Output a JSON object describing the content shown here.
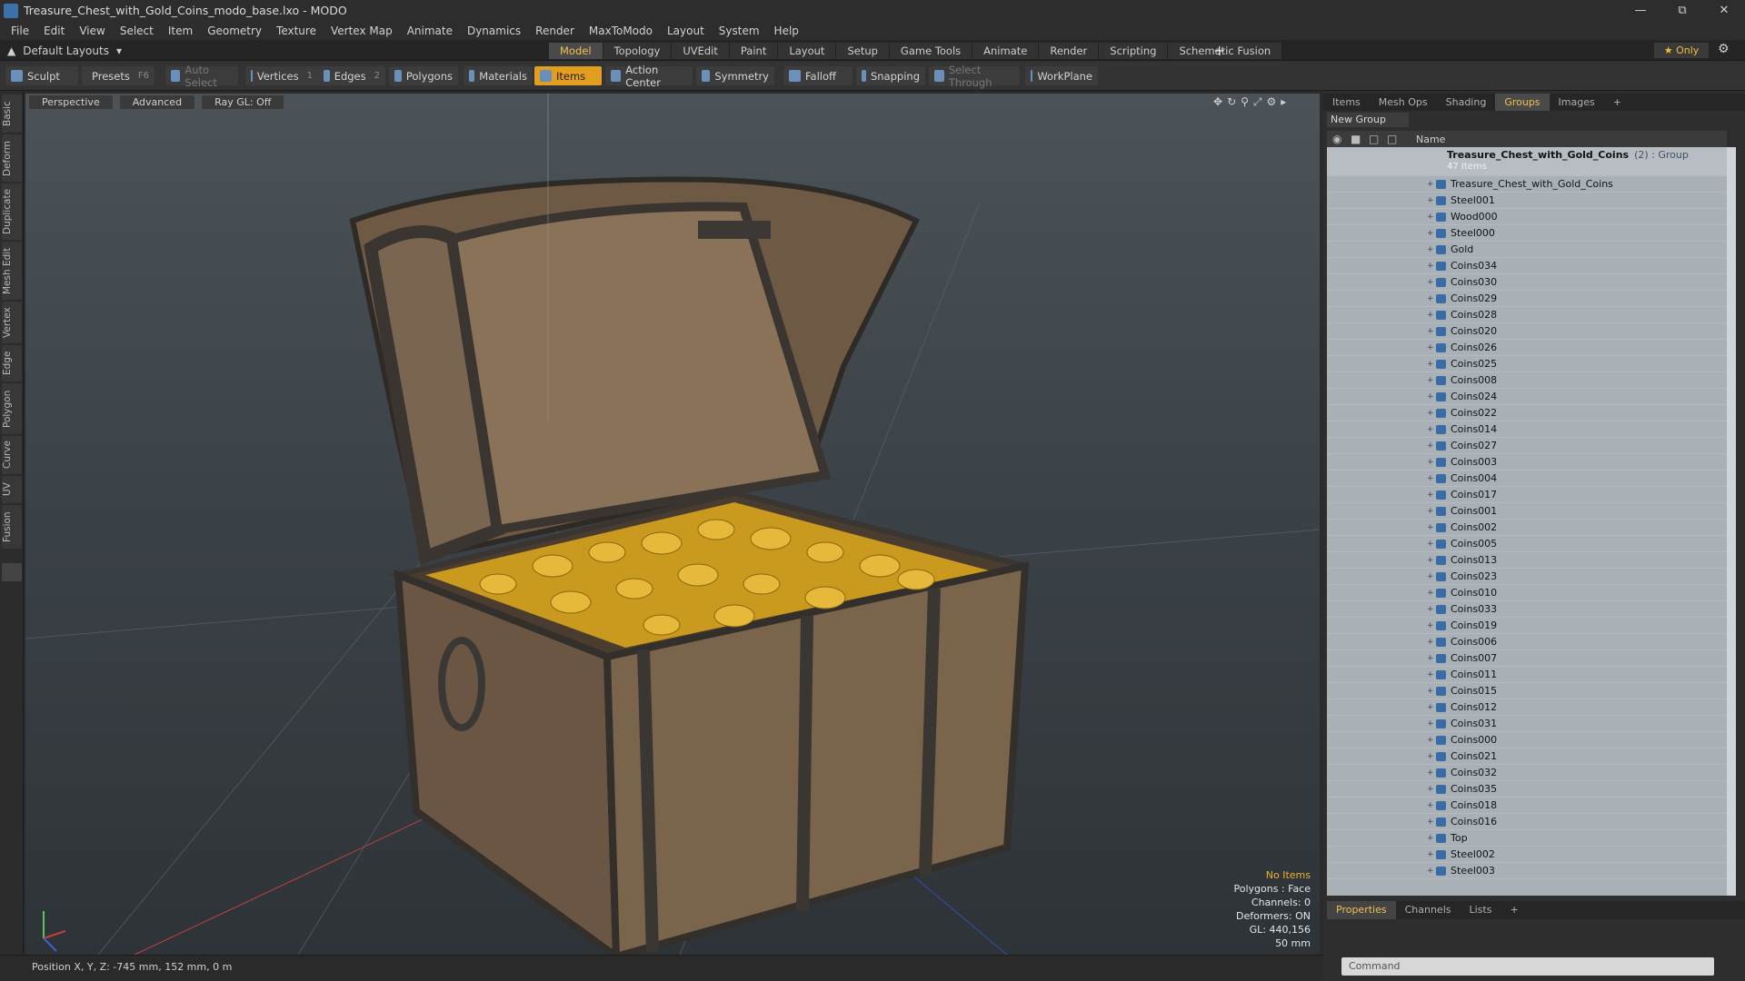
{
  "window": {
    "title": "Treasure_Chest_with_Gold_Coins_modo_base.lxo - MODO"
  },
  "menu": [
    "File",
    "Edit",
    "View",
    "Select",
    "Item",
    "Geometry",
    "Texture",
    "Vertex Map",
    "Animate",
    "Dynamics",
    "Render",
    "MaxToModo",
    "Layout",
    "System",
    "Help"
  ],
  "tabs": {
    "layout": "Default Layouts",
    "modes": [
      "Model",
      "Topology",
      "UVEdit",
      "Paint",
      "Layout",
      "Setup",
      "Game Tools",
      "Animate",
      "Render",
      "Scripting",
      "Schematic Fusion"
    ],
    "only": "Only"
  },
  "toolbar": {
    "sculpt": "Sculpt",
    "presets": "Presets",
    "presets_key": "F6",
    "auto_select": "Auto Select",
    "vertices": "Vertices",
    "vertices_n": "1",
    "edges": "Edges",
    "edges_n": "2",
    "polygons": "Polygons",
    "materials": "Materials",
    "items": "Items",
    "action_center": "Action Center",
    "symmetry": "Symmetry",
    "falloff": "Falloff",
    "snapping": "Snapping",
    "select_through": "Select Through",
    "workplane": "WorkPlane"
  },
  "left_tabs": [
    "Basic",
    "Deform",
    "Duplicate",
    "Mesh Edit",
    "Vertex",
    "Edge",
    "Polygon",
    "Curve",
    "UV",
    "Fusion"
  ],
  "viewport": {
    "view": "Perspective",
    "shading": "Advanced",
    "raygl": "Ray GL: Off",
    "info": {
      "items": "No Items",
      "polygons": "Polygons : Face",
      "channels": "Channels: 0",
      "deformers": "Deformers: ON",
      "gl": "GL: 440,156",
      "size": "50 mm"
    }
  },
  "status": {
    "position": "Position X, Y, Z:  -745 mm, 152 mm, 0 m"
  },
  "right_tabs": [
    "Items",
    "Mesh Ops",
    "Shading",
    "Groups",
    "Images"
  ],
  "groups": {
    "new_group": "New Group",
    "name_header": "Name",
    "root": {
      "name": "Treasure_Chest_with_Gold_Coins",
      "count": "(2) : Group",
      "sub": "47 Items"
    },
    "items": [
      "Treasure_Chest_with_Gold_Coins",
      "Steel001",
      "Wood000",
      "Steel000",
      "Gold",
      "Coins034",
      "Coins030",
      "Coins029",
      "Coins028",
      "Coins020",
      "Coins026",
      "Coins025",
      "Coins008",
      "Coins024",
      "Coins022",
      "Coins014",
      "Coins027",
      "Coins003",
      "Coins004",
      "Coins017",
      "Coins001",
      "Coins002",
      "Coins005",
      "Coins013",
      "Coins023",
      "Coins010",
      "Coins033",
      "Coins019",
      "Coins006",
      "Coins007",
      "Coins011",
      "Coins015",
      "Coins012",
      "Coins031",
      "Coins000",
      "Coins021",
      "Coins032",
      "Coins035",
      "Coins018",
      "Coins016",
      "Top",
      "Steel002",
      "Steel003"
    ]
  },
  "properties_tabs": [
    "Properties",
    "Channels",
    "Lists"
  ],
  "command": {
    "placeholder": "Command"
  }
}
